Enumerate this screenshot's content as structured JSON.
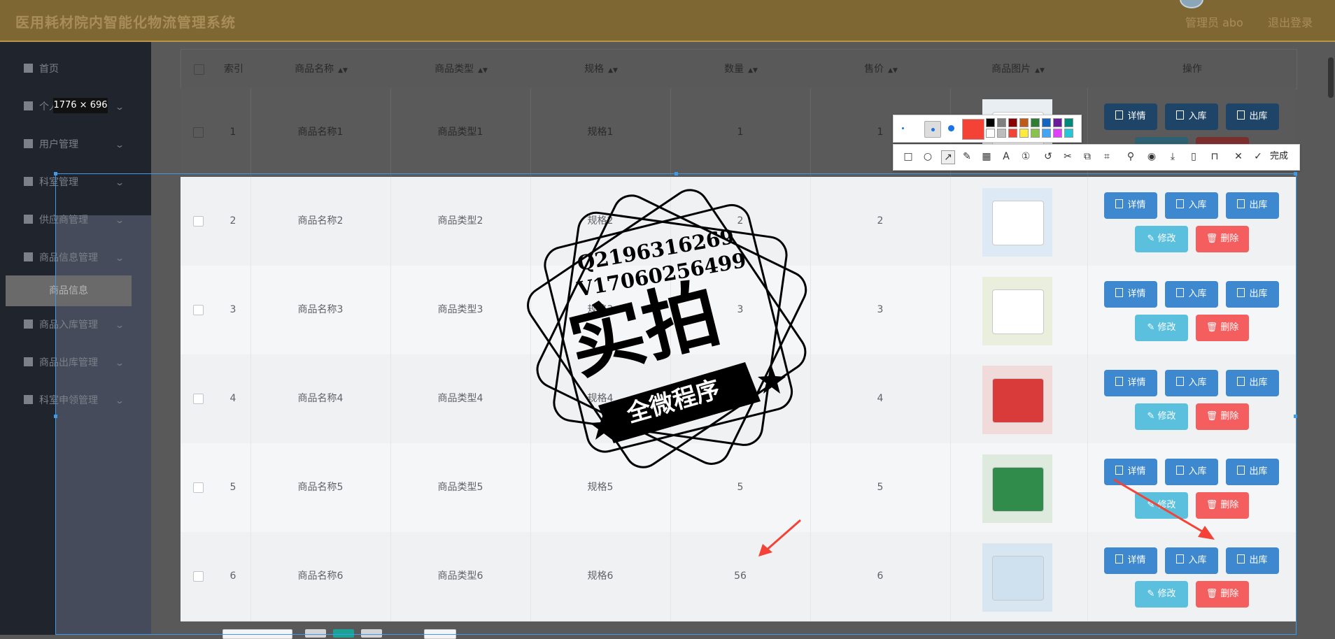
{
  "header": {
    "app_title": "医用耗材院内智能化物流管理系统",
    "admin_label": "管理员 abo",
    "logout_label": "退出登录"
  },
  "sidebar": {
    "items": [
      {
        "label": "首页",
        "icon": "home-icon"
      },
      {
        "label": "个人中心",
        "icon": "user-icon"
      },
      {
        "label": "用户管理",
        "icon": "chart-icon"
      },
      {
        "label": "科室管理",
        "icon": "grid-icon"
      },
      {
        "label": "供应商管理",
        "icon": "grid-icon"
      },
      {
        "label": "商品信息管理",
        "icon": "briefcase-icon"
      },
      {
        "label": "商品入库管理",
        "icon": "grid-icon"
      },
      {
        "label": "商品出库管理",
        "icon": "send-icon"
      },
      {
        "label": "科室申领管理",
        "icon": "user-icon"
      }
    ],
    "active_sub": "商品信息",
    "size_badge": "1776 × 696"
  },
  "table": {
    "headers": [
      "索引",
      "商品名称",
      "商品类型",
      "规格",
      "数量",
      "售价",
      "商品图片",
      "操作"
    ],
    "rows": [
      {
        "index": "1",
        "name": "商品名称1",
        "type": "商品类型1",
        "spec": "规格1",
        "qty": "1",
        "price": "1"
      },
      {
        "index": "2",
        "name": "商品名称2",
        "type": "商品类型2",
        "spec": "规格2",
        "qty": "2",
        "price": "2"
      },
      {
        "index": "3",
        "name": "商品名称3",
        "type": "商品类型3",
        "spec": "规格3",
        "qty": "3",
        "price": "3"
      },
      {
        "index": "4",
        "name": "商品名称4",
        "type": "商品类型4",
        "spec": "规格4",
        "qty": "4",
        "price": "4"
      },
      {
        "index": "5",
        "name": "商品名称5",
        "type": "商品类型5",
        "spec": "规格5",
        "qty": "5",
        "price": "5"
      },
      {
        "index": "6",
        "name": "商品名称6",
        "type": "商品类型6",
        "spec": "规格6",
        "qty": "56",
        "price": "6"
      }
    ],
    "actions": {
      "detail": "详情",
      "in": "入库",
      "out": "出库",
      "edit": "修改",
      "delete": "删除"
    }
  },
  "toolbar": {
    "done_label": "完成",
    "current_color": "#f44336",
    "palette": [
      "#000000",
      "#7f7f7f",
      "#8b0000",
      "#c05a1b",
      "#2e7d32",
      "#1565c0",
      "#6a1b9a",
      "#00897b",
      "#ffffff",
      "#bdbdbd",
      "#f44336",
      "#ffeb3b",
      "#8bc34a",
      "#42a5f5",
      "#e040fb",
      "#26c6da"
    ],
    "tools": [
      "rectangle-icon",
      "ellipse-icon",
      "arrow-icon",
      "pencil-icon",
      "mosaic-icon",
      "text-icon",
      "number-marker-icon",
      "undo-icon",
      "scissors-icon",
      "translate-icon",
      "ocr-icon",
      "pin-icon",
      "record-icon",
      "download-icon",
      "phone-icon",
      "bookmark-icon",
      "close-icon",
      "check-icon"
    ]
  },
  "stamp": {
    "line1": "Q2196316269",
    "line2": "V17060256499",
    "main": "实拍",
    "banner": "全微程序"
  }
}
